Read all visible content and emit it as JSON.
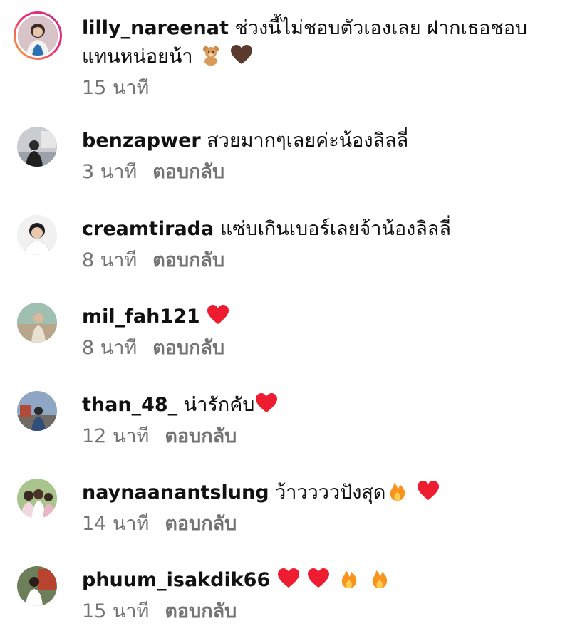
{
  "colors": {
    "username": "#111111",
    "meta_text": "#737373",
    "story_ring": "#ee2a7b",
    "heart_red": "#ed1c30",
    "heart_brown": "#5a3a2c",
    "fire": "#f7931e"
  },
  "comments": [
    {
      "username": "lilly_nareenat",
      "text_line1": "ช่วงนี้ไม่ชอบตัวเองเลย ฝากเธอชอบ",
      "text_line2": "แทนหน่อยน้า",
      "emojis": [
        "teddy-bear-icon",
        "brown-heart-icon"
      ],
      "time": "15 นาที",
      "reply_label": ""
    },
    {
      "username": "benzapwer",
      "text_line1": "สวยมากๆเลยค่ะน้องลิลลี่",
      "emojis": [],
      "time": "3 นาที",
      "reply_label": "ตอบกลับ"
    },
    {
      "username": "creamtirada",
      "text_line1": "แซ่บเกินเบอร์เลยจ้าน้องลิลลี่",
      "emojis": [],
      "time": "8 นาที",
      "reply_label": "ตอบกลับ"
    },
    {
      "username": "mil_fah121",
      "text_line1": "",
      "emojis": [
        "red-heart-icon"
      ],
      "time": "8 นาที",
      "reply_label": "ตอบกลับ"
    },
    {
      "username": "than_48_",
      "text_line1": "น่ารักคับ",
      "emojis": [
        "red-heart-icon"
      ],
      "time": "12 นาที",
      "reply_label": "ตอบกลับ"
    },
    {
      "username": "naynaanantslung",
      "text_line1": "ว้าววววปังสุด",
      "emojis": [
        "fire-icon",
        "red-heart-icon"
      ],
      "time": "14 นาที",
      "reply_label": "ตอบกลับ"
    },
    {
      "username": "phuum_isakdik66",
      "text_line1": "",
      "emojis": [
        "red-heart-icon",
        "red-heart-icon",
        "fire-icon",
        "fire-icon"
      ],
      "time": "15 นาที",
      "reply_label": "ตอบกลับ"
    }
  ]
}
